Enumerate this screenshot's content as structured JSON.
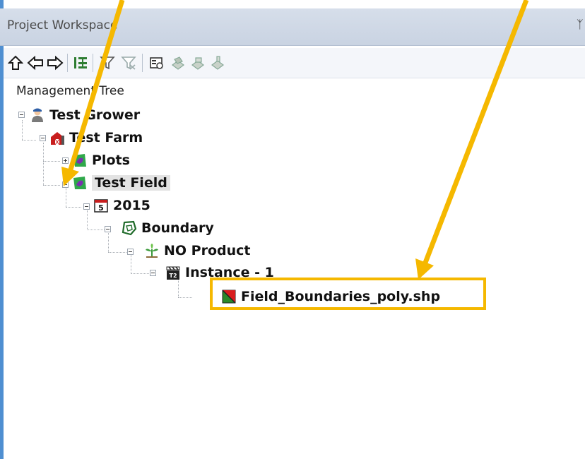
{
  "panel": {
    "title": "Project Workspace",
    "pin_glyph": "ᛉ"
  },
  "toolbar": {
    "buttons": [
      {
        "icon": "arrow-up-icon"
      },
      {
        "icon": "arrow-left-icon"
      },
      {
        "icon": "arrow-right-icon"
      },
      {
        "icon": "tree-view-icon"
      },
      {
        "icon": "filter-icon"
      },
      {
        "icon": "filter-clear-icon"
      },
      {
        "icon": "properties-icon"
      },
      {
        "icon": "layer-icon-1"
      },
      {
        "icon": "layer-icon-2"
      },
      {
        "icon": "layer-icon-3"
      }
    ]
  },
  "tree": {
    "root_label": "Management Tree",
    "nodes": {
      "grower": "Test Grower",
      "farm": "Test Farm",
      "plots": "Plots",
      "field": "Test Field",
      "year": "2015",
      "boundary": "Boundary",
      "product": "NO Product",
      "instance": "Instance - 1",
      "file": "Field_Boundaries_poly.shp"
    },
    "year_icon_text": "5",
    "instance_icon_text": "T2"
  },
  "colors": {
    "callout": "#f5b800",
    "accent_border": "#4f8fd1"
  }
}
